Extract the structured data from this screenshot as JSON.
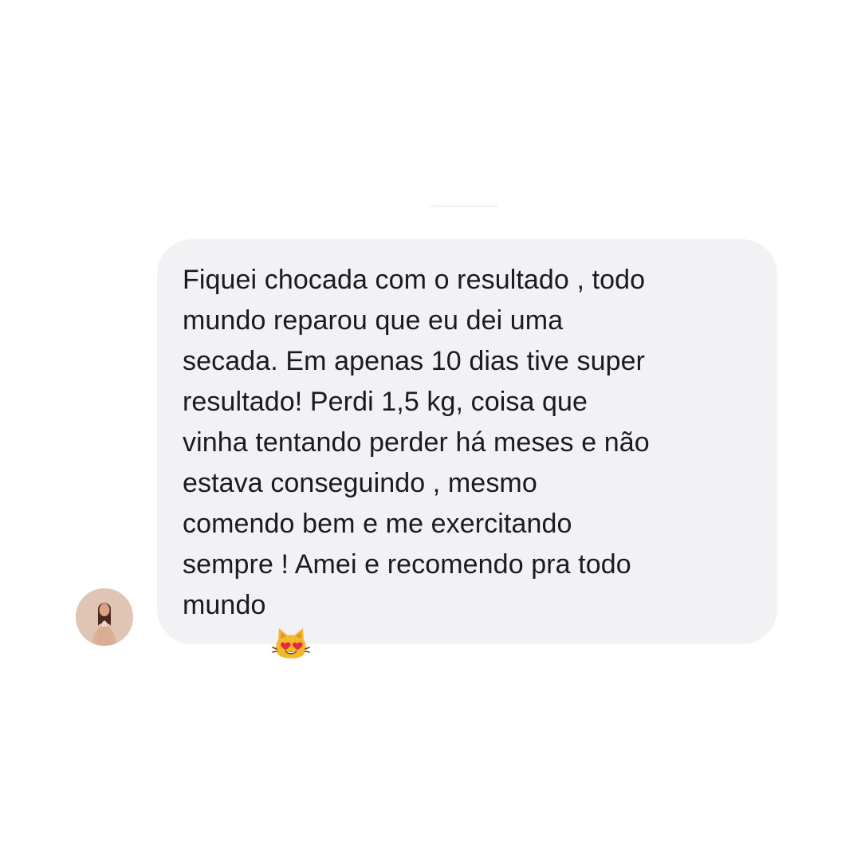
{
  "conversation": {
    "message": {
      "text": "Fiquei chocada com o resultado , todo\nmundo reparou que eu dei uma\nsecada. Em apenas 10 dias tive super\nresultado! Perdi 1,5 kg, coisa que\nvinha tentando perder há meses e não\nestava conseguindo , mesmo\ncomendo bem e me exercitando\nsempre ! Amei e recomendo pra todo\nmundo",
      "emoji_icon": "heart-eyes-cat-icon"
    },
    "sender": {
      "avatar_icon": "user-avatar-photo"
    }
  },
  "colors": {
    "background": "#ffffff",
    "bubble": "#f2f2f4",
    "text": "#1b1b1d",
    "emoji": "#f2b92e"
  }
}
